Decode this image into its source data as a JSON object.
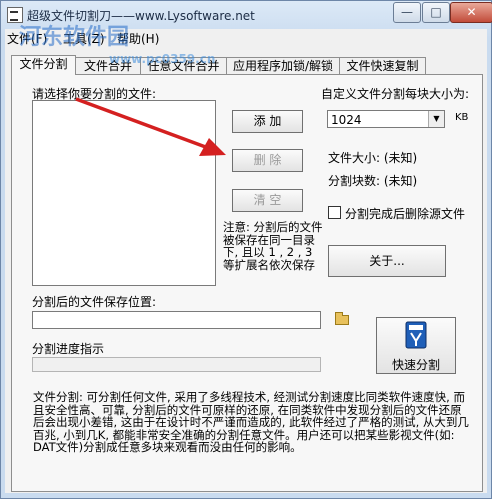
{
  "window": {
    "title": "超级文件切割刀——www.Lysoftware.net",
    "watermark": "河东软件园",
    "watermark_url": "www.pc0359.cn",
    "min_glyph": "—",
    "max_glyph": "□",
    "close_glyph": "✕"
  },
  "menu": [
    "文件(F)",
    "工具(Z)",
    "帮助(H)"
  ],
  "tabs": [
    "文件分割",
    "文件合并",
    "任意文件合并",
    "应用程序加锁/解锁",
    "文件快速复制"
  ],
  "split": {
    "select_label": "请选择你要分割的文件:",
    "add_btn": "添  加",
    "delete_btn": "删  除",
    "clear_btn": "清  空",
    "custom_size_label": "自定义文件分割每块大小为:",
    "block_size_value": "1024",
    "unit": "KB",
    "file_size_label": "文件大小:  (未知)",
    "block_count_label": "分割块数:  (未知)",
    "delete_source_label": "分割完成后删除源文件",
    "note": "注意: 分割后的文件被保存在同一目录下, 且以 1 , 2 , 3等扩展名依次保存",
    "about_btn": "关于...",
    "save_location_label": "分割后的文件保存位置:",
    "save_location_value": "",
    "quick_split_btn": "快速分割",
    "progress_label": "分割进度指示",
    "progress": 0,
    "description": "文件分割: 可分割任何文件, 采用了多线程技术, 经测试分割速度比同类软件速度快, 而且安全性高、可靠, 分割后的文件可原样的还原, 在同类软件中发现分割后的文件还原后会出现小差错, 这由于在设计时不严谨而造成的, 此软件经过了严格的测试, 从大到几百兆, 小到几K, 都能非常安全准确的分割任意文件。用户还可以把某些影视文件(如: DAT文件)分割成任意多块来观看而没由任何的影响。"
  },
  "colors": {
    "accent_arrow": "#d42020"
  }
}
